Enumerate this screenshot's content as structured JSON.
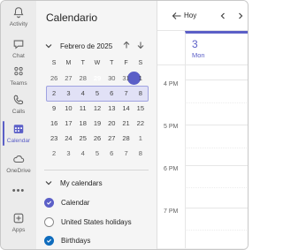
{
  "rail": {
    "items": [
      {
        "label": "Activity",
        "icon": "bell-icon"
      },
      {
        "label": "Chat",
        "icon": "chat-icon"
      },
      {
        "label": "Teams",
        "icon": "teams-icon"
      },
      {
        "label": "Calls",
        "icon": "phone-icon"
      },
      {
        "label": "Calendar",
        "icon": "calendar-icon",
        "active": true
      },
      {
        "label": "OneDrive",
        "icon": "cloud-icon"
      },
      {
        "label": "•••",
        "icon": "more-icon"
      },
      {
        "label": "Apps",
        "icon": "apps-icon"
      }
    ]
  },
  "pane": {
    "title": "Calendario",
    "month_label": "Febrero de 2025",
    "dow": [
      "S",
      "M",
      "T",
      "W",
      "T",
      "F",
      "S"
    ],
    "weeks": [
      [
        "26",
        "27",
        "28",
        "29",
        "30",
        "31",
        "1"
      ],
      [
        "2",
        "3",
        "4",
        "5",
        "6",
        "7",
        "8"
      ],
      [
        "9",
        "10",
        "11",
        "12",
        "13",
        "14",
        "15"
      ],
      [
        "16",
        "17",
        "18",
        "19",
        "20",
        "21",
        "22"
      ],
      [
        "23",
        "24",
        "25",
        "26",
        "27",
        "28",
        "1"
      ],
      [
        "2",
        "3",
        "4",
        "5",
        "6",
        "7",
        "8"
      ]
    ],
    "today": "29",
    "my_calendars_label": "My calendars",
    "calendars": [
      {
        "label": "Calendar",
        "checked": true,
        "color": "#5b5fc7"
      },
      {
        "label": "United States holidays",
        "checked": false
      },
      {
        "label": "Birthdays",
        "checked": true,
        "color": "#0f6cbd"
      }
    ]
  },
  "view": {
    "today_label": "Hoy",
    "day_number": "3",
    "day_name": "Mon",
    "hours": [
      "4 PM",
      "5 PM",
      "6 PM",
      "7 PM"
    ]
  },
  "colors": {
    "accent": "#5b5fc7",
    "week_highlight": "#e1e1f6",
    "rail_bg": "#ebebeb"
  }
}
